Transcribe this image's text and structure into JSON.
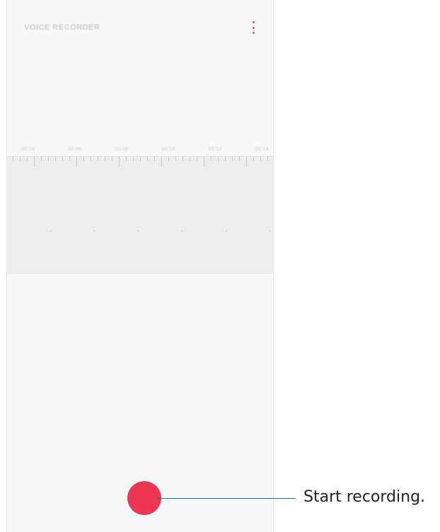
{
  "app": {
    "title": "VOICE RECORDER",
    "menu_icon": "more-vert-icon",
    "accent_color": "#e2543f"
  },
  "timeline": {
    "labels": [
      "00:04",
      "00:06",
      "00:08",
      "00:10",
      "00:12",
      "00:14"
    ]
  },
  "record": {
    "icon": "record-icon",
    "color": "#ec3656"
  },
  "callout": {
    "text": "Start recording."
  }
}
